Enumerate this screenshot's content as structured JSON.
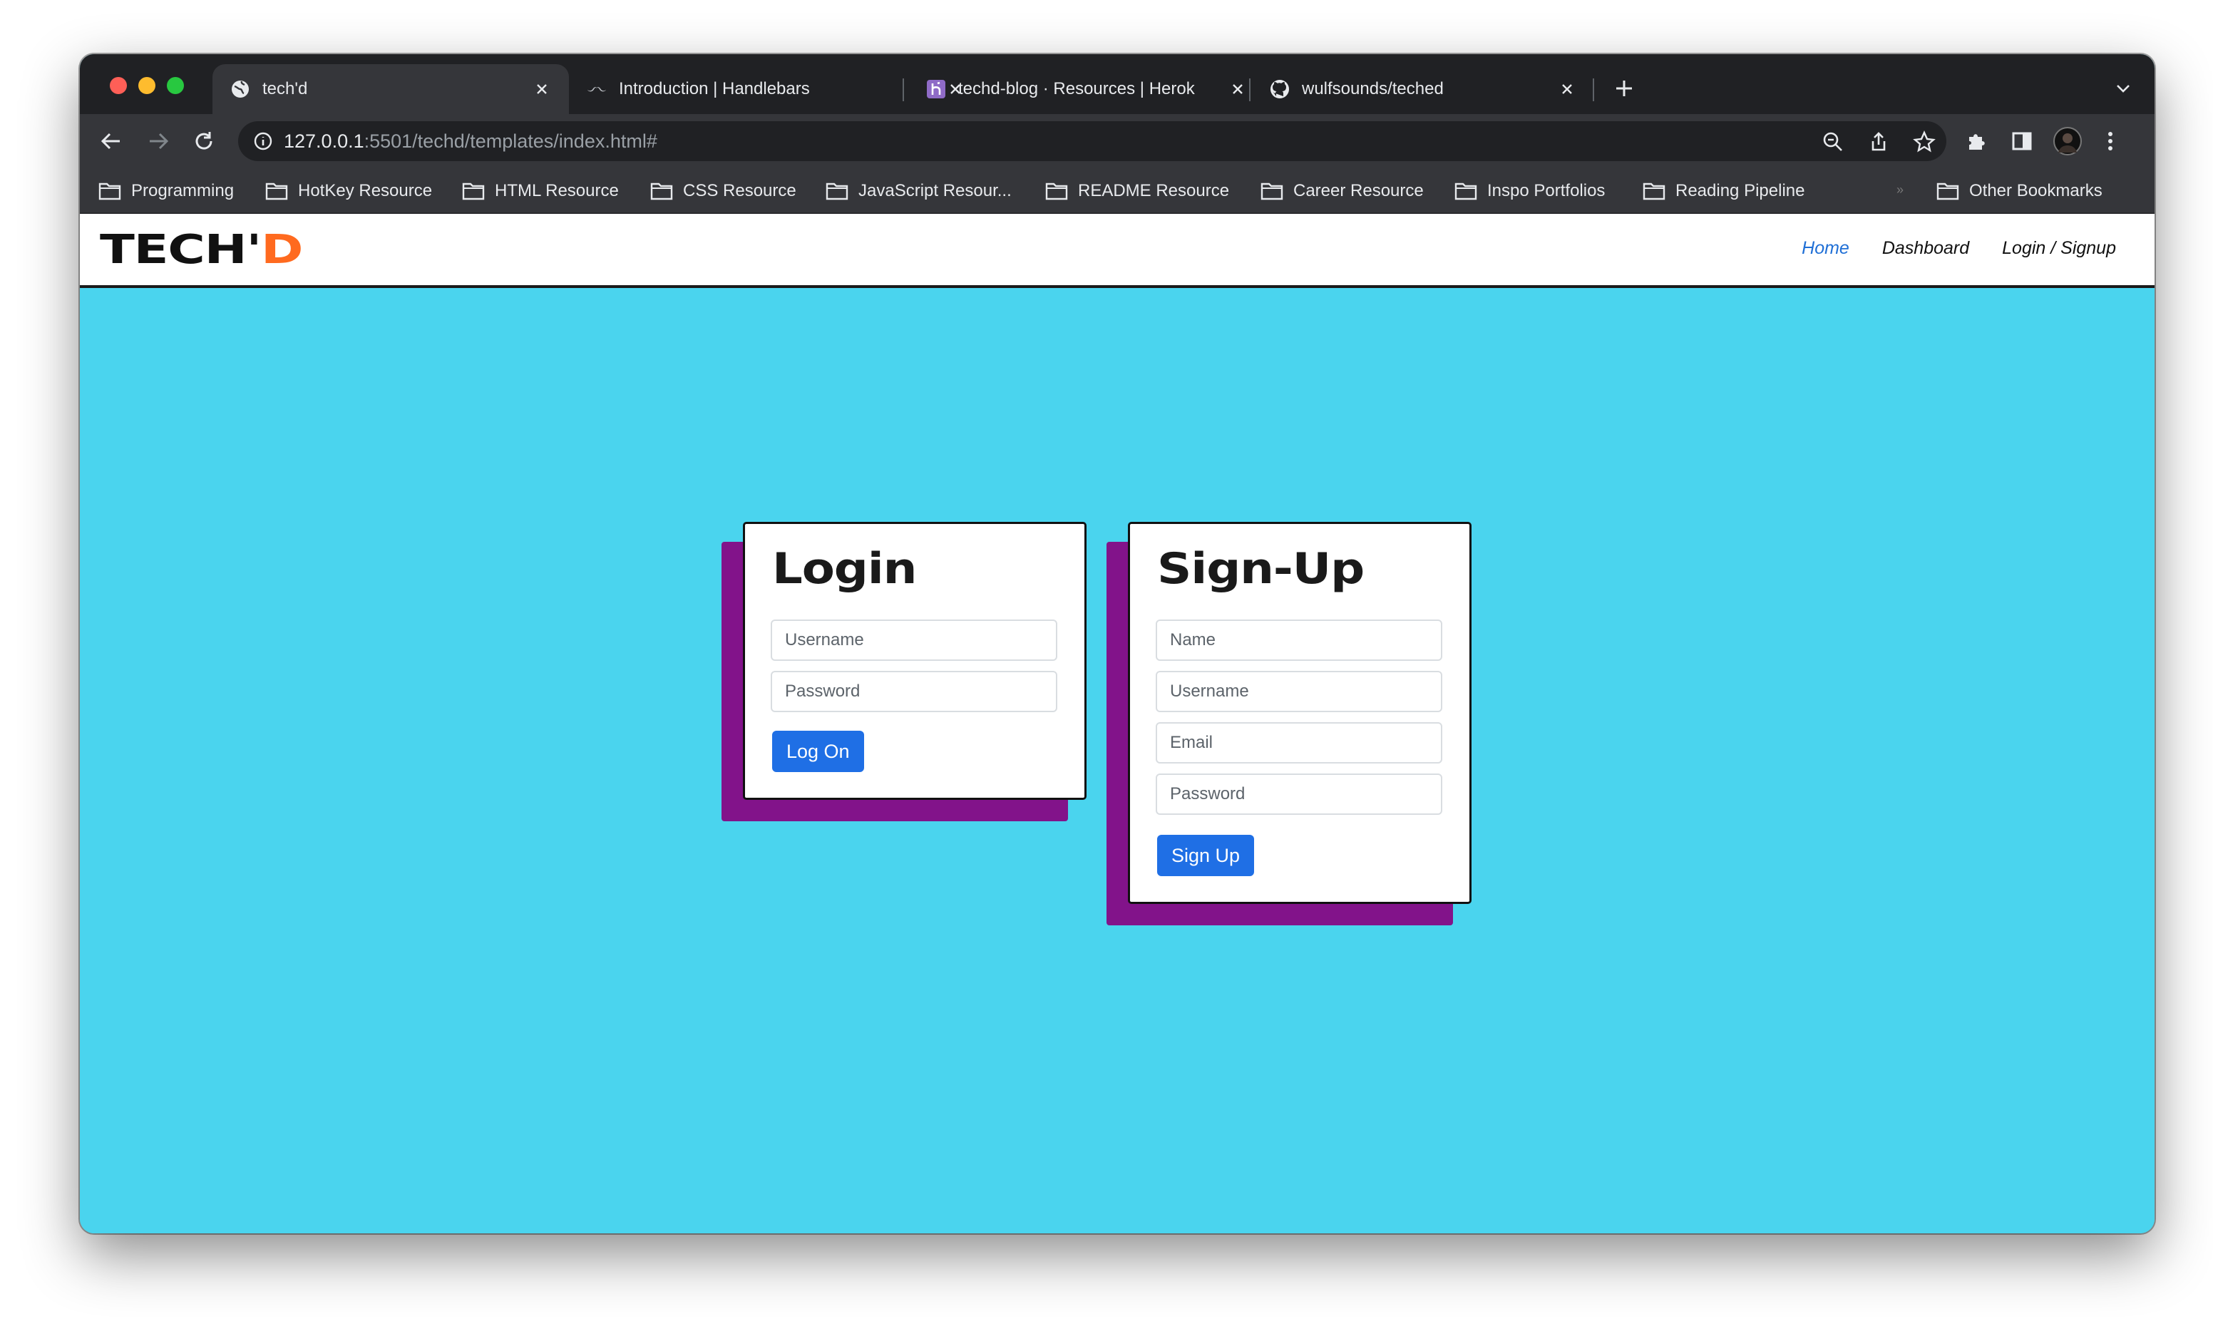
{
  "browser": {
    "tabs": [
      {
        "title": "tech'd",
        "icon": "globe-icon",
        "active": true
      },
      {
        "title": "Introduction | Handlebars",
        "icon": "handlebars-mustache-icon",
        "active": false
      },
      {
        "title": "techd-blog · Resources | Herok",
        "icon": "heroku-icon",
        "active": false
      },
      {
        "title": "wulfsounds/teched",
        "icon": "github-icon",
        "active": false
      }
    ],
    "address": {
      "host": "127.0.0.1",
      "path": ":5501/techd/templates/index.html#"
    },
    "bookmarks": [
      "Programming",
      "HotKey Resource",
      "HTML Resource",
      "CSS Resource",
      "JavaScript Resour...",
      "README Resource",
      "Career Resource",
      "Inspo Portfolios",
      "Reading Pipeline"
    ],
    "bookmarks_overflow": "»",
    "other_bookmarks": "Other Bookmarks"
  },
  "site": {
    "logo_main": "TECH'",
    "logo_accent": "D",
    "nav": [
      {
        "label": "Home",
        "current": true
      },
      {
        "label": "Dashboard",
        "current": false
      },
      {
        "label": "Login / Signup",
        "current": false
      }
    ]
  },
  "login": {
    "title": "Login",
    "username_placeholder": "Username",
    "password_placeholder": "Password",
    "submit_label": "Log On"
  },
  "signup": {
    "title": "Sign-Up",
    "name_placeholder": "Name",
    "username_placeholder": "Username",
    "email_placeholder": "Email",
    "password_placeholder": "Password",
    "submit_label": "Sign Up"
  },
  "colors": {
    "page_background": "#4ad4ee",
    "card_shadow": "#82138a",
    "button": "#1f6fe5",
    "logo_accent": "#ff6a1f",
    "active_nav": "#1f6fd6"
  }
}
